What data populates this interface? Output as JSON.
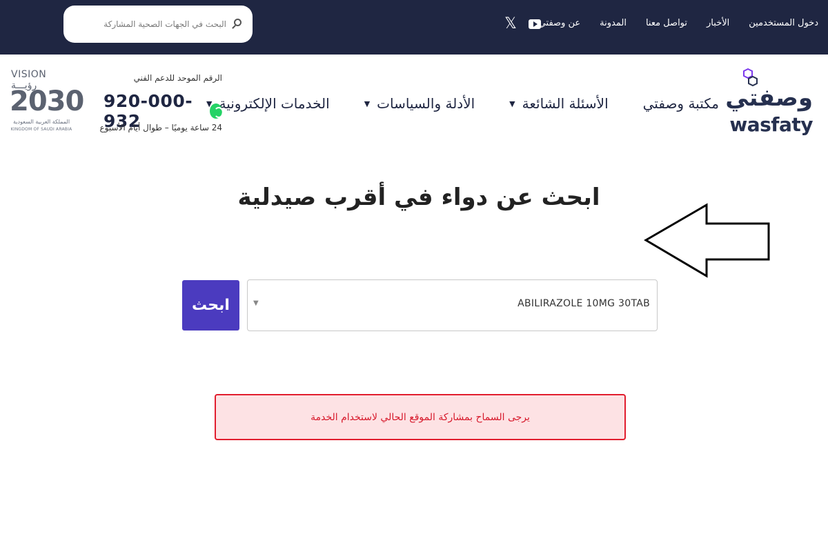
{
  "topbar": {
    "links": [
      "عن وصفتي",
      "المدونة",
      "تواصل معنا",
      "الأخبار",
      "دخول المستخدمين"
    ],
    "social": [
      "youtube-icon",
      "x-icon"
    ],
    "search_placeholder": "البحث في الجهات الصحية المشاركة",
    "bg_color": "#1f2642"
  },
  "logo": {
    "arabic": "وصفتي",
    "english": "wasfaty"
  },
  "nav": {
    "items": [
      {
        "label": "الخدمات الإلكترونية",
        "has_dropdown": true
      },
      {
        "label": "الأدلة والسياسات",
        "has_dropdown": true
      },
      {
        "label": "الأسئلة الشائعة",
        "has_dropdown": true
      },
      {
        "label": "مكتبة وصفتي",
        "has_dropdown": false
      }
    ]
  },
  "support": {
    "title": "الرقم الموحد للدعم الفني",
    "phone": "920-000-932",
    "hours": "24 ساعة يوميًا – طوال أيام الأسبوع"
  },
  "vision": {
    "line1": "VISION رؤيـــة",
    "line2": "2030",
    "line3": "المملكة العربية السعودية",
    "line4": "KINGDOM OF SAUDI ARABIA"
  },
  "main": {
    "title": "ابحث عن دواء في أقرب صيدلية",
    "selected_drug": "ABILIRAZOLE 10MG 30TAB",
    "search_button": "ابحث",
    "alert": "يرجى السماح بمشاركة الموقع الحالي لاستخدام الخدمة",
    "accent_color": "#4b3bbf",
    "alert_color": "#e11d2e"
  }
}
